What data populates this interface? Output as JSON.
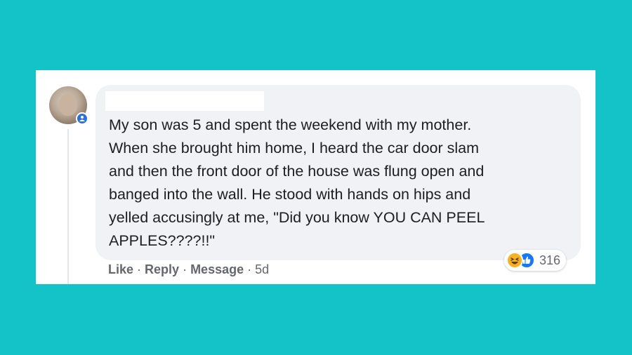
{
  "comment": {
    "text": "My son was 5 and spent the weekend with my mother.\nWhen she brought him home, I heard the car door slam\nand then the front door of the house was flung open and\nbanged into the wall. He stood with hands on hips and\nyelled accusingly at me, \"Did you know YOU CAN PEEL\nAPPLES????!!\"",
    "author_redacted": true
  },
  "actions": {
    "like_label": "Like",
    "reply_label": "Reply",
    "message_label": "Message",
    "separator": "·",
    "timestamp": "5d"
  },
  "reactions": {
    "icons": [
      "haha-icon",
      "like-icon"
    ],
    "count": "316"
  },
  "colors": {
    "background": "#14c3c8",
    "bubble": "#f0f2f5",
    "text": "#1c1e21",
    "meta": "#65676b",
    "like_blue": "#1877f2",
    "haha_yellow": "#f7b125"
  }
}
